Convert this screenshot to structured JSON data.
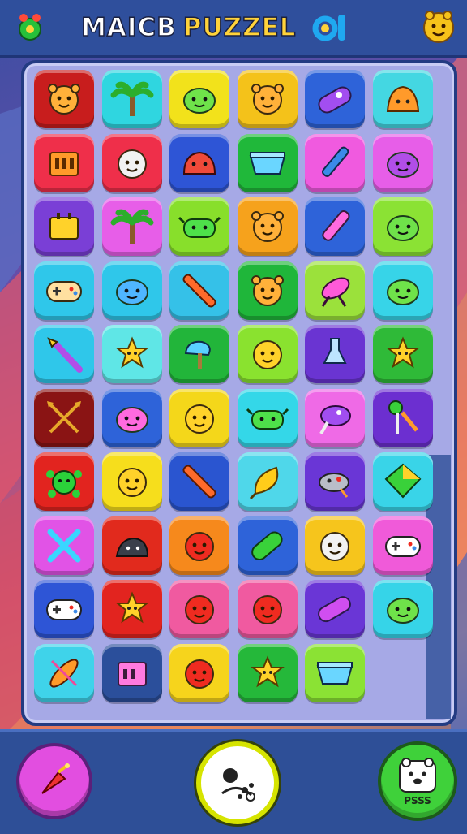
{
  "header": {
    "title_word1": "MAICB",
    "title_word2": "PUZZEL",
    "left_icon": "green-creature-icon",
    "mid_icon": "blue-ring-icon",
    "right_icon": "smiley-face-icon"
  },
  "board": {
    "rows": 10,
    "cols": 6,
    "tiles": [
      [
        {
          "color": "#c81d1d",
          "icon": "orange-face"
        },
        {
          "color": "#2fd6e0",
          "icon": "palm-tree"
        },
        {
          "color": "#f2e21b",
          "icon": "green-blob"
        },
        {
          "color": "#f4c21a",
          "icon": "orange-face"
        },
        {
          "color": "#2e63d9",
          "icon": "purple-capsule"
        },
        {
          "color": "#44d7e2",
          "icon": "orange-blob"
        }
      ],
      [
        {
          "color": "#ef2f4a",
          "icon": "orange-box"
        },
        {
          "color": "#ef2f4a",
          "icon": "white-face"
        },
        {
          "color": "#2e55d6",
          "icon": "red-creature"
        },
        {
          "color": "#20b83a",
          "icon": "blue-tray"
        },
        {
          "color": "#f05adf",
          "icon": "blue-pen"
        },
        {
          "color": "#e75ee8",
          "icon": "purple-blob"
        }
      ],
      [
        {
          "color": "#7a3fd6",
          "icon": "yellow-box"
        },
        {
          "color": "#e75ee8",
          "icon": "palm-tree"
        },
        {
          "color": "#88df2b",
          "icon": "green-creature"
        },
        {
          "color": "#f6a21c",
          "icon": "orange-face"
        },
        {
          "color": "#2e63d9",
          "icon": "pink-pen"
        },
        {
          "color": "#8be234",
          "icon": "green-blob"
        }
      ],
      [
        {
          "color": "#2fc7ea",
          "icon": "gamepad"
        },
        {
          "color": "#2fc7ea",
          "icon": "blue-blob"
        },
        {
          "color": "#35c1e8",
          "icon": "orange-stick"
        },
        {
          "color": "#1fb63a",
          "icon": "orange-face"
        },
        {
          "color": "#9be13b",
          "icon": "pink-rocket"
        },
        {
          "color": "#37d4e8",
          "icon": "green-blob"
        }
      ],
      [
        {
          "color": "#2fc7ea",
          "icon": "wand"
        },
        {
          "color": "#5fe6e6",
          "icon": "yellow-star"
        },
        {
          "color": "#22b53a",
          "icon": "blue-popsicle"
        },
        {
          "color": "#8ae22f",
          "icon": "yellow-face"
        },
        {
          "color": "#6a34d2",
          "icon": "blue-bottle"
        },
        {
          "color": "#2fba38",
          "icon": "yellow-star"
        }
      ],
      [
        {
          "color": "#8a1414",
          "icon": "crossed-arrows"
        },
        {
          "color": "#2e63d9",
          "icon": "pink-blob"
        },
        {
          "color": "#f4d71a",
          "icon": "yellow-face"
        },
        {
          "color": "#34d7e8",
          "icon": "green-creature"
        },
        {
          "color": "#ef6ae6",
          "icon": "purple-lollipop"
        },
        {
          "color": "#6c2fd0",
          "icon": "green-lollipop"
        }
      ],
      [
        {
          "color": "#e2241f",
          "icon": "green-virus"
        },
        {
          "color": "#f6de1c",
          "icon": "yellow-face"
        },
        {
          "color": "#2a55d0",
          "icon": "orange-stick"
        },
        {
          "color": "#4fd7ea",
          "icon": "yellow-leaf"
        },
        {
          "color": "#6a36d6",
          "icon": "grey-fish"
        },
        {
          "color": "#39d4e8",
          "icon": "green-kite"
        }
      ],
      [
        {
          "color": "#e153e6",
          "icon": "crossed-sticks"
        },
        {
          "color": "#e12a1d",
          "icon": "grey-creature"
        },
        {
          "color": "#f6891c",
          "icon": "red-face"
        },
        {
          "color": "#2e63d9",
          "icon": "green-pill"
        },
        {
          "color": "#f6c51c",
          "icon": "white-face"
        },
        {
          "color": "#f05ad9",
          "icon": "gamepad-white"
        }
      ],
      [
        {
          "color": "#2e55d6",
          "icon": "gamepad-white"
        },
        {
          "color": "#e2241f",
          "icon": "yellow-star"
        },
        {
          "color": "#f05aa0",
          "icon": "red-face"
        },
        {
          "color": "#f05aa0",
          "icon": "red-face"
        },
        {
          "color": "#6a36d6",
          "icon": "pink-capsule"
        },
        {
          "color": "#36d4e8",
          "icon": "green-blob"
        }
      ],
      [
        {
          "color": "#3fd3ea",
          "icon": "surfboard"
        },
        {
          "color": "#2b4f9b",
          "icon": "pink-box"
        },
        {
          "color": "#f6d41c",
          "icon": "red-face"
        },
        {
          "color": "#25b83a",
          "icon": "yellow-star"
        },
        {
          "color": "#8be234",
          "icon": "blue-tray"
        },
        null
      ]
    ]
  },
  "footer": {
    "left_button_icon": "bomb-icon",
    "center_button_icon": "shuffle-icon",
    "right_button_icon": "bear-face-icon",
    "right_button_label": "PSSS"
  }
}
